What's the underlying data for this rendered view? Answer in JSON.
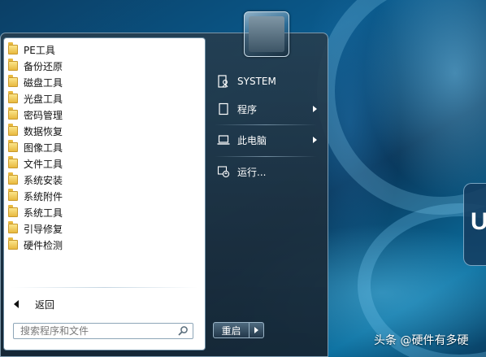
{
  "programs": [
    {
      "label": "PE工具"
    },
    {
      "label": "备份还原"
    },
    {
      "label": "磁盘工具"
    },
    {
      "label": "光盘工具"
    },
    {
      "label": "密码管理"
    },
    {
      "label": "数据恢复"
    },
    {
      "label": "图像工具"
    },
    {
      "label": "文件工具"
    },
    {
      "label": "系统安装"
    },
    {
      "label": "系统附件"
    },
    {
      "label": "系统工具"
    },
    {
      "label": "引导修复"
    },
    {
      "label": "硬件检测"
    }
  ],
  "back_label": "返回",
  "search": {
    "placeholder": "搜索程序和文件"
  },
  "right_pane": {
    "user": "SYSTEM",
    "programs": "程序",
    "computer": "此电脑",
    "run": "运行..."
  },
  "restart_label": "重启",
  "watermark": "头条 @硬件有多硬",
  "desktop_tile_letter": "U",
  "icons": {
    "folder": "folder-icon",
    "search": "search-icon",
    "user": "user-icon",
    "programs": "programs-icon",
    "computer": "computer-icon",
    "run": "run-icon"
  },
  "colors": {
    "desktop": "#0a5a8c",
    "menu_frame": "#263e50",
    "folder": "#e8b93f"
  }
}
